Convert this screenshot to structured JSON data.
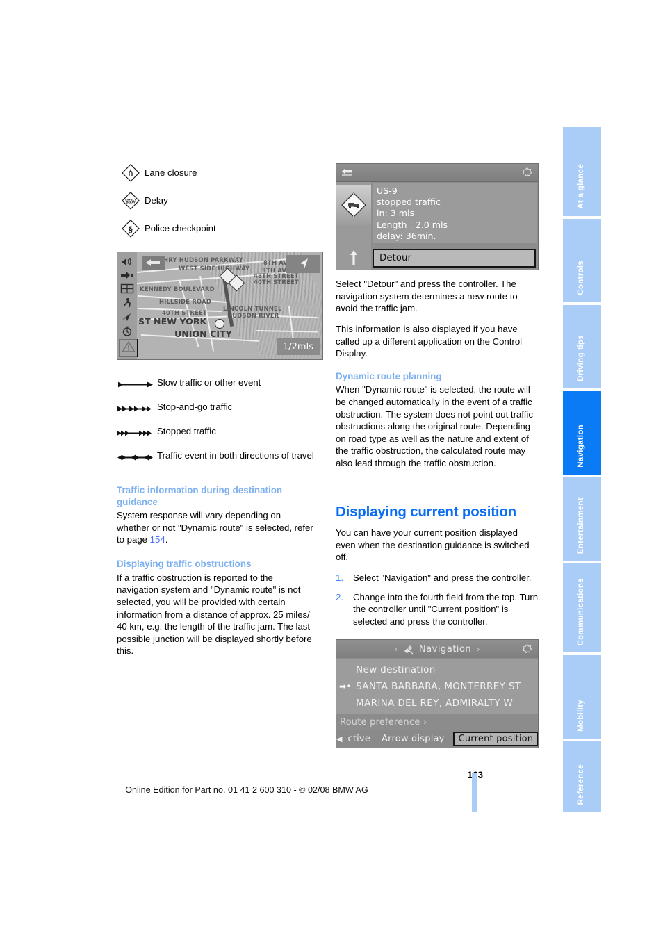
{
  "document": {
    "page_number": "163",
    "footer_text": "Online Edition for Part no. 01 41 2 600 310 - © 02/08 BMW AG"
  },
  "tabs": [
    {
      "label": "At a glance",
      "active": false
    },
    {
      "label": "Controls",
      "active": false
    },
    {
      "label": "Driving tips",
      "active": false
    },
    {
      "label": "Navigation",
      "active": true
    },
    {
      "label": "Entertainment",
      "active": false
    },
    {
      "label": "Communications",
      "active": false
    },
    {
      "label": "Mobility",
      "active": false
    },
    {
      "label": "Reference",
      "active": false
    }
  ],
  "colors": {
    "tab_inactive": "#a9cdf7",
    "tab_active": "#0a7bf5",
    "heading_primary": "#0a6ef5",
    "heading_secondary": "#7db0ef",
    "page_link": "#4b6ef5",
    "list_number": "#3d7ff0"
  },
  "left_column": {
    "symbol_legend": [
      {
        "icon": "lane-closure-sign-icon",
        "label": "Lane closure"
      },
      {
        "icon": "delay-sign-icon",
        "label": "Delay",
        "sign_text": "EXPECT DELAY"
      },
      {
        "icon": "police-checkpoint-sign-icon",
        "label": "Police checkpoint",
        "sign_text": "§"
      }
    ],
    "traffic_flow_legend": [
      {
        "icon": "slow-traffic-arrow-icon",
        "label": "Slow traffic or other event"
      },
      {
        "icon": "stop-and-go-arrow-icon",
        "label": "Stop-and-go traffic"
      },
      {
        "icon": "stopped-traffic-arrow-icon",
        "label": "Stopped traffic"
      },
      {
        "icon": "both-directions-arrow-icon",
        "label": "Traffic event in both directions of travel"
      }
    ],
    "sections": [
      {
        "heading": "Traffic information during destination guidance",
        "heading_level": "sub",
        "paragraphs": [
          "System response will vary depending on whether or not \"Dynamic route\" is selected, refer to page "
        ],
        "page_reference": "154"
      },
      {
        "heading": "Displaying traffic obstructions",
        "heading_level": "sub",
        "paragraphs": [
          "If a traffic obstruction is reported to the navigation system and \"Dynamic route\" is not selected, you will be provided with certain information from a distance of approx. 25 miles/ 40 km, e.g. the length of the traffic jam. The last possible junction will be displayed shortly before this."
        ]
      }
    ]
  },
  "right_column": {
    "sections": [
      {
        "paragraphs": [
          "Select \"Detour\" and press the controller. The navigation system determines a new route to avoid the traffic jam.",
          "This information is also displayed if you have called up a different application on the Control Display."
        ]
      },
      {
        "heading": "Dynamic route planning",
        "heading_level": "sub",
        "paragraphs": [
          "When \"Dynamic route\" is selected, the route will be changed automatically in the event of a traffic obstruction. The system does not point out traffic obstructions along the original route. Depending on road type as well as the nature and extent of the traffic obstruction, the calculated route may also lead through the traffic obstruction."
        ]
      },
      {
        "heading": "Displaying current position",
        "heading_level": "main",
        "paragraphs": [
          "You can have your current position displayed even when the destination guidance is switched off."
        ],
        "steps": [
          {
            "num": "1.",
            "text": "Select \"Navigation\" and press the controller."
          },
          {
            "num": "2.",
            "text": "Change into the fourth field from the top. Turn the controller until \"Current position\" is selected and press the controller."
          }
        ]
      }
    ]
  },
  "traffic_screen": {
    "back_icon": "back-arrow-icon",
    "gear_icon": "gear-icon",
    "sign_icon": "stopped-traffic-sign-icon",
    "direction_icon": "up-arrow-icon",
    "lines": [
      "US-9",
      "stopped traffic",
      "in: 3 mls",
      "Length : 2.0 mls",
      "delay: 36min."
    ],
    "button_label": "Detour"
  },
  "nav_screen": {
    "title": "Navigation",
    "left_caret": "‹",
    "right_caret": "›",
    "satellite_icon": "satellite-icon",
    "gear_icon": "gear-icon",
    "items": [
      "New destination",
      "SANTA BARBARA, MONTERREY ST",
      "MARINA DEL REY, ADMIRALTY W"
    ],
    "route_preference": "Route preference ›",
    "bottom_bar": {
      "left_arrow": "◀",
      "right_arrow": "▶",
      "items": [
        "ctive",
        "Arrow display"
      ],
      "selected_item": "Current position"
    }
  },
  "map_screen": {
    "scale_label": "1/2mls",
    "sidebar_icons": [
      "speaker-icon",
      "arrow-repeat-icon",
      "split-screen-icon",
      "pedestrian-icon",
      "compass-arrow-icon",
      "clock-icon",
      "traffic-warning-icon"
    ],
    "back_icon": "map-back-icon",
    "direction_icon": "map-direction-arrow-icon",
    "roads": [
      "HRY HUDSON PARKWAY",
      "WEST SIDE HIGHWAY",
      "8TH AV",
      "9TH AVE",
      "48TH STREET",
      "40TH STREET",
      "KENNEDY BOULEVARD",
      "HILLSIDE ROAD",
      "40TH STREET",
      "LINCOLN TUNNEL",
      "HUDSON RIVER"
    ],
    "cities": [
      "ST NEW YORK",
      "UNION CITY"
    ]
  }
}
